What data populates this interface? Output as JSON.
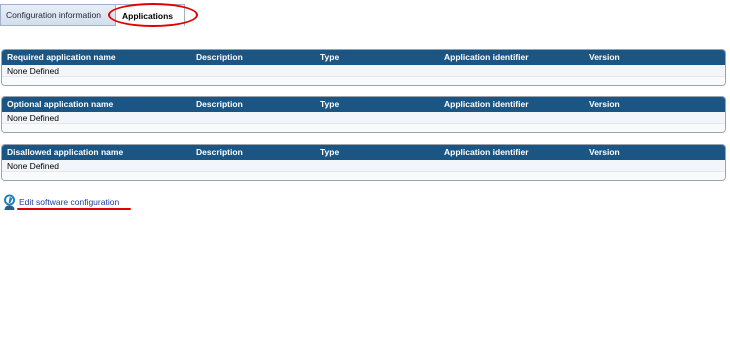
{
  "tabs": {
    "config_label": "Configuration information",
    "apps_label": "Applications"
  },
  "tables": {
    "required": {
      "headers": [
        "Required application name",
        "Description",
        "Type",
        "Application identifier",
        "Version"
      ],
      "empty_text": "None Defined"
    },
    "optional": {
      "headers": [
        "Optional application name",
        "Description",
        "Type",
        "Application identifier",
        "Version"
      ],
      "empty_text": "None Defined"
    },
    "disallowed": {
      "headers": [
        "Disallowed application name",
        "Description",
        "Type",
        "Application identifier",
        "Version"
      ],
      "empty_text": "None Defined"
    }
  },
  "edit": {
    "label": "Edit software configuration",
    "icon": "edit-person-icon"
  },
  "colors": {
    "header_bg": "#1b5584",
    "link": "#1a3f9a",
    "annotation": "#e00000"
  }
}
